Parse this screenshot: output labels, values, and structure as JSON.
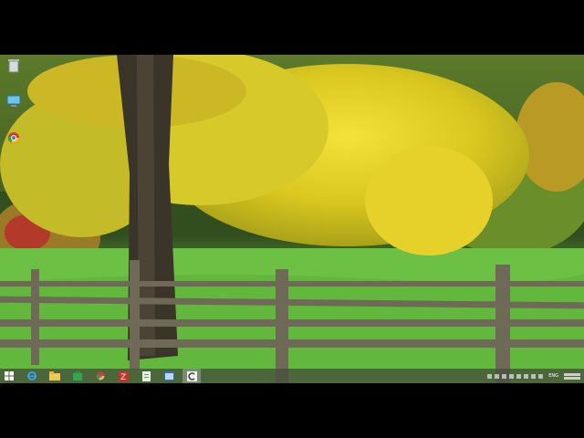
{
  "desktop": {
    "icons": [
      {
        "name": "recycle-bin-icon"
      },
      {
        "name": "computer-icon"
      },
      {
        "name": "chrome-icon"
      }
    ]
  },
  "taskbar": {
    "items": [
      {
        "name": "start-button",
        "icon": "windows-logo-icon"
      },
      {
        "name": "taskbar-ie",
        "icon": "internet-explorer-icon"
      },
      {
        "name": "taskbar-explorer",
        "icon": "file-explorer-icon"
      },
      {
        "name": "taskbar-store",
        "icon": "store-icon"
      },
      {
        "name": "taskbar-chrome",
        "icon": "chrome-icon"
      },
      {
        "name": "taskbar-filezilla",
        "icon": "filezilla-icon"
      },
      {
        "name": "taskbar-notepad",
        "icon": "document-icon"
      },
      {
        "name": "taskbar-app",
        "icon": "window-icon"
      },
      {
        "name": "taskbar-active-app",
        "icon": "c-app-icon"
      }
    ],
    "tray_count": 8,
    "language": "ENG"
  },
  "colors": {
    "taskbar": "#4a5040",
    "grass": "#5fbf3c",
    "foliage": "#e8d22a"
  }
}
